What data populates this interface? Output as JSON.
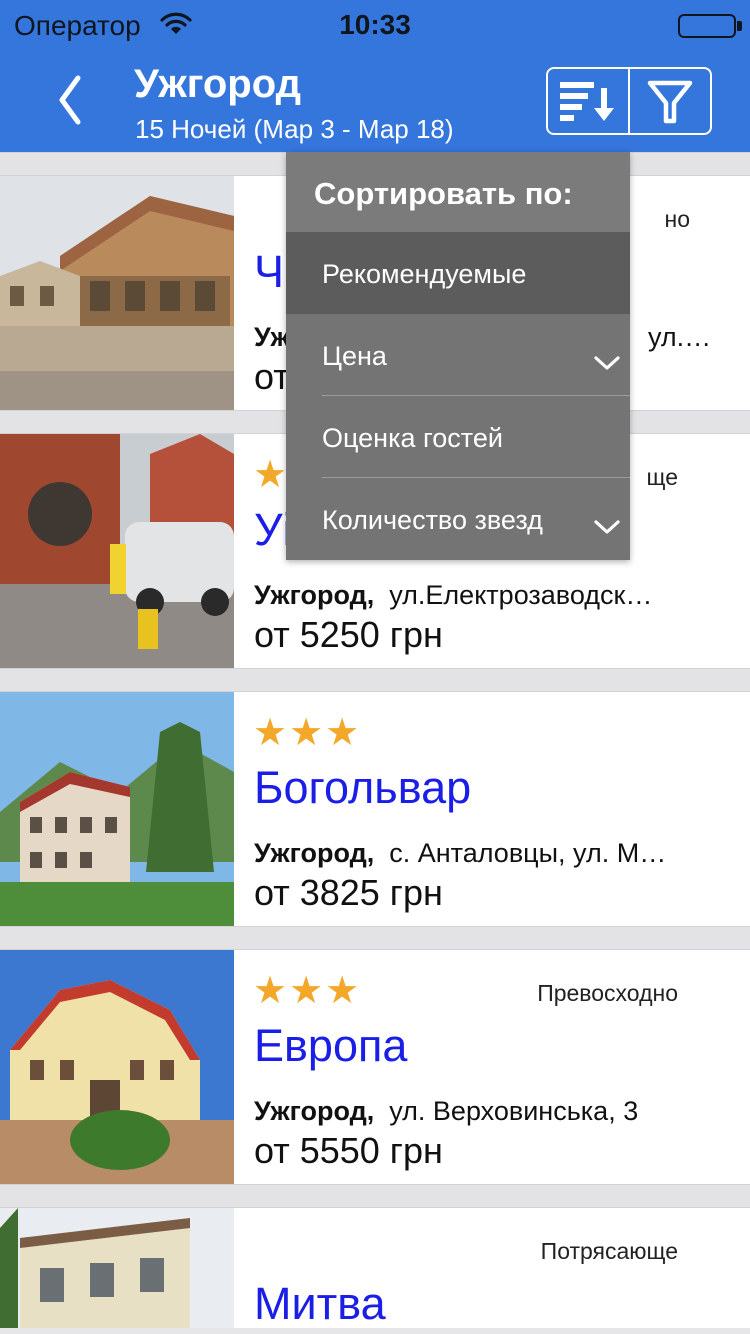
{
  "status_bar": {
    "carrier": "Оператор",
    "time": "10:33"
  },
  "nav": {
    "title": "Ужгород",
    "subtitle": "15 Ночей (Мар 3 - Мар 18)",
    "icons": [
      "back-chevron-icon",
      "sort-icon",
      "filter-funnel-icon"
    ]
  },
  "sort_menu": {
    "header": "Сортировать по:",
    "options": [
      {
        "label": "Рекомендуемые",
        "selected": true
      },
      {
        "label": "Цена",
        "selected": false
      },
      {
        "label": "Оценка гостей",
        "selected": false
      },
      {
        "label": "Количество звезд",
        "selected": false
      }
    ]
  },
  "hotels": [
    {
      "stars": "",
      "rating": "но",
      "name": "Ч",
      "city": "Ужг",
      "street": "ул.…",
      "price": "от"
    },
    {
      "stars": "★",
      "rating": "ще",
      "name": "Уі",
      "city": "Ужгород,",
      "street": "ул.Електрозаводск…",
      "price": "от 5250 грн"
    },
    {
      "stars": "★★★",
      "rating": "",
      "name": "Богольвар",
      "city": "Ужгород,",
      "street": "с. Анталовцы, ул. М…",
      "price": "от 3825 грн"
    },
    {
      "stars": "★★★",
      "rating": "Превосходно",
      "name": "Европа",
      "city": "Ужгород,",
      "street": "ул. Верховинська, 3",
      "price": "от 5550 грн"
    },
    {
      "stars": "",
      "rating": "Потрясающе",
      "name": "Митва",
      "city": "",
      "street": "",
      "price": ""
    }
  ],
  "colors": {
    "nav_blue": "#3476dc",
    "hotel_name_blue": "#1a1ee6",
    "star_orange": "#f3a829",
    "menu_gray": "#747474",
    "menu_selected": "#5c5c5c"
  }
}
